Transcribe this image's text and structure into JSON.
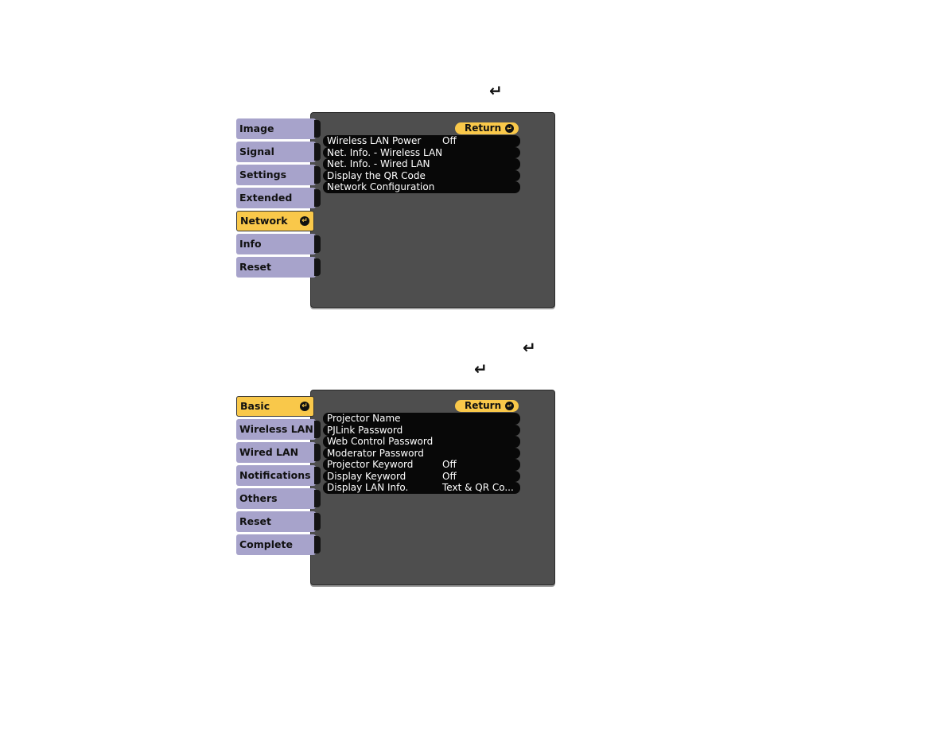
{
  "enter_icon": "↵",
  "menu1": {
    "sidebar": [
      "Image",
      "Signal",
      "Settings",
      "Extended",
      "Network",
      "Info",
      "Reset"
    ],
    "selected_index": 4,
    "return_label": "Return",
    "rows": [
      {
        "label": "Wireless LAN Power",
        "value": "Off"
      },
      {
        "label": "Net. Info. - Wireless LAN",
        "value": ""
      },
      {
        "label": "Net. Info. - Wired LAN",
        "value": ""
      },
      {
        "label": "Display the QR Code",
        "value": ""
      },
      {
        "label": "Network Configuration",
        "value": ""
      }
    ]
  },
  "menu2": {
    "sidebar": [
      "Basic",
      "Wireless LAN",
      "Wired LAN",
      "Notifications",
      "Others",
      "Reset",
      "Complete"
    ],
    "selected_index": 0,
    "return_label": "Return",
    "rows": [
      {
        "label": "Projector Name",
        "value": ""
      },
      {
        "label": "PJLink Password",
        "value": ""
      },
      {
        "label": "Web Control Password",
        "value": ""
      },
      {
        "label": "Moderator Password",
        "value": ""
      },
      {
        "label": "Projector Keyword",
        "value": "Off"
      },
      {
        "label": "Display Keyword",
        "value": "Off"
      },
      {
        "label": "Display LAN Info.",
        "value": "Text & QR Co..."
      }
    ]
  }
}
